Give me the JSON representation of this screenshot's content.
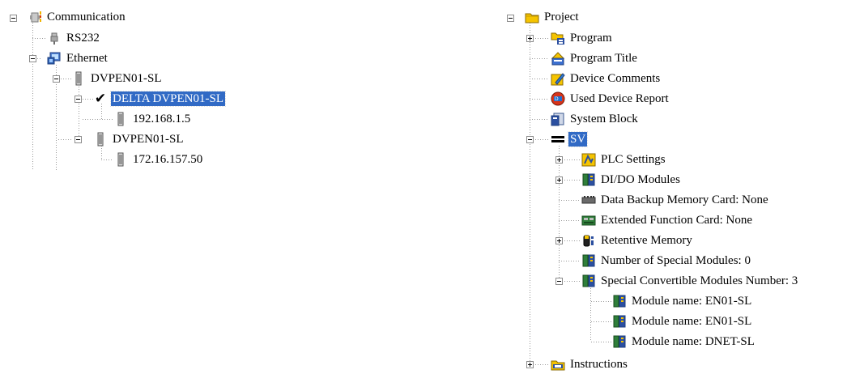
{
  "left_tree": {
    "root": "Communication",
    "rs232": "RS232",
    "ethernet": "Ethernet",
    "device1": "DVPEN01-SL",
    "device1_child": "DELTA DVPEN01-SL",
    "ip1": "192.168.1.5",
    "device2": "DVPEN01-SL",
    "ip2": "172.16.157.50"
  },
  "right_tree": {
    "root": "Project",
    "program": "Program",
    "program_title": "Program Title",
    "device_comments": "Device Comments",
    "used_device_report": "Used Device Report",
    "system_block": "System Block",
    "sv": "SV",
    "plc_settings": "PLC Settings",
    "dido_modules": "DI/DO Modules",
    "data_backup": "Data Backup Memory Card: None",
    "extended_function": "Extended Function Card: None",
    "retentive_memory": "Retentive Memory",
    "num_special_modules": "Number of Special Modules: 0",
    "special_convertible": "Special Convertible Modules Number: 3",
    "module1": "Module name: EN01-SL",
    "module2": "Module name: EN01-SL",
    "module3": "Module name: DNET-SL",
    "instructions": "Instructions"
  },
  "colors": {
    "selection": "#316ac5",
    "tree_lines": "#9a9a9a",
    "folder": "#f5c400",
    "module_green": "#2f7f3a",
    "module_blue": "#2b4fa0"
  },
  "icons": {
    "communication": "communication-icon",
    "rs232": "plug-icon",
    "ethernet": "network-icon",
    "device": "module-icon",
    "check": "check-icon",
    "project": "folder-icon",
    "instructions": "api-folder-icon"
  }
}
